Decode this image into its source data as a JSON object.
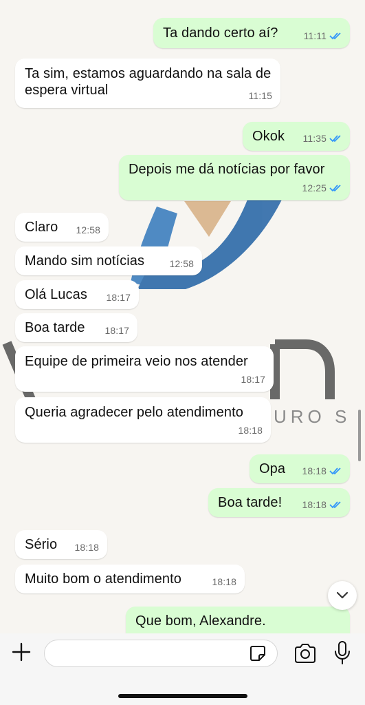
{
  "messages": [
    {
      "dir": "out",
      "text": "Ta dando certo aí?",
      "time": "11:11",
      "read": true
    },
    {
      "dir": "in",
      "text": "Ta sim, estamos aguardando na sala de espera virtual",
      "time": "11:15"
    },
    {
      "dir": "out",
      "text": "Okok",
      "time": "11:35",
      "read": true
    },
    {
      "dir": "out",
      "text": "Depois me dá notícias por favor",
      "time": "12:25",
      "read": true
    },
    {
      "dir": "in",
      "text": "Claro",
      "time": "12:58"
    },
    {
      "dir": "in",
      "text": "Mando sim notícias",
      "time": "12:58"
    },
    {
      "dir": "in",
      "text": "Olá Lucas",
      "time": "18:17"
    },
    {
      "dir": "in",
      "text": "Boa tarde",
      "time": "18:17"
    },
    {
      "dir": "in",
      "text": "Equipe de primeira veio nos atender",
      "time": "18:17"
    },
    {
      "dir": "in",
      "text": "Queria agradecer pelo atendimento",
      "time": "18:18"
    },
    {
      "dir": "out",
      "text": "Opa",
      "time": "18:18",
      "read": true
    },
    {
      "dir": "out",
      "text": "Boa tarde!",
      "time": "18:18",
      "read": true
    },
    {
      "dir": "in",
      "text": "Sério",
      "time": "18:18"
    },
    {
      "dir": "in",
      "text": "Muito bom o atendimento",
      "time": "18:18"
    },
    {
      "dir": "out",
      "text": "Que bom, Alexandre.",
      "time": "",
      "read": false
    }
  ],
  "composer": {
    "value": ""
  },
  "icons": {
    "plus": "plus-icon",
    "sticker": "sticker-icon",
    "camera": "camera-icon",
    "mic": "microphone-icon",
    "scroll": "chevron-down-icon",
    "read": "double-check-icon"
  },
  "colors": {
    "outgoing": "#d9fdd3",
    "incoming": "#ffffff",
    "read_ticks": "#3497f9",
    "wallpaper_logo_blue": "#2e6fb0",
    "wallpaper_logo_gold": "#d8b389"
  },
  "wallpaper": {
    "brand_fragment": "URO S"
  }
}
